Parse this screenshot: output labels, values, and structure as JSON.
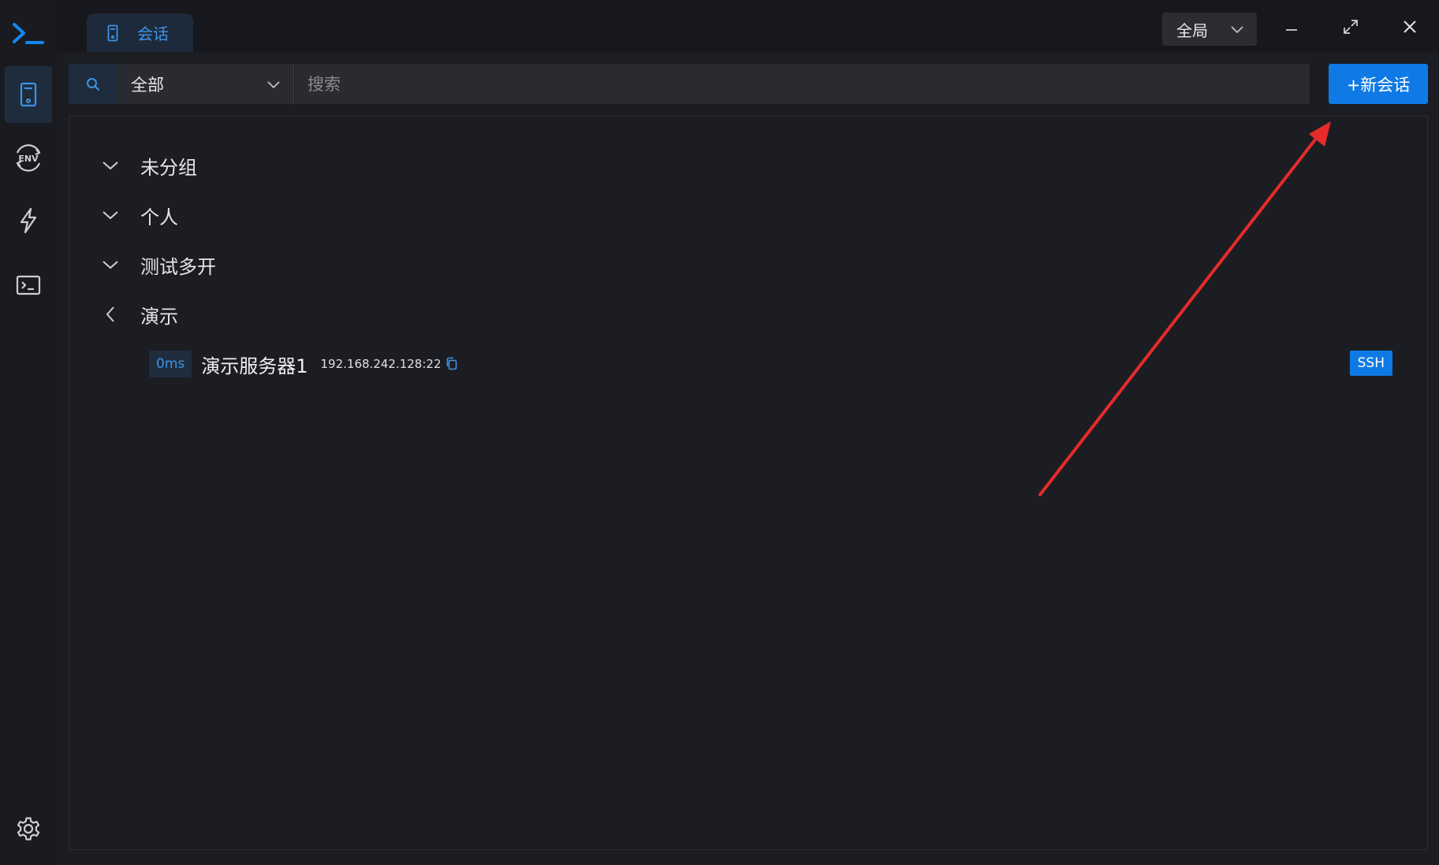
{
  "topbar": {
    "tab_label": "会话",
    "scope_label": "全局"
  },
  "search": {
    "filter_value": "全部",
    "placeholder": "搜索",
    "new_session_label": "+新会话"
  },
  "groups": [
    {
      "name": "未分组",
      "expanded": true
    },
    {
      "name": "个人",
      "expanded": true
    },
    {
      "name": "测试多开",
      "expanded": true
    },
    {
      "name": "演示",
      "expanded": false
    }
  ],
  "session": {
    "latency": "0ms",
    "name": "演示服务器1",
    "host": "192.168.242.128:22",
    "protocol": "SSH"
  },
  "colors": {
    "accent": "#0f7ae5",
    "annotation_arrow": "#e52b2b"
  }
}
